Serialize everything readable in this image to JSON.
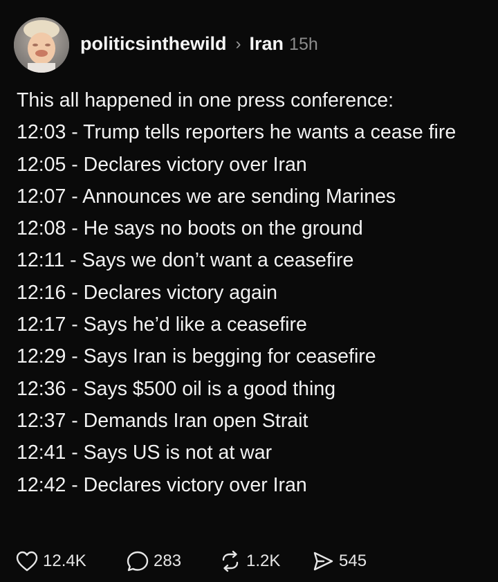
{
  "post": {
    "username": "politicsinthewild",
    "separator": "›",
    "topic": "Iran",
    "time": "15h",
    "intro": "This all happened in one press conference:",
    "entries": [
      "12:03 - Trump tells reporters he wants a cease fire",
      "12:05 - Declares victory over Iran",
      "12:07 - Announces we are sending Marines",
      "12:08 - He says no boots on the ground",
      "12:11 - Says we don’t want a ceasefire",
      "12:16 - Declares victory again",
      "12:17 - Says he’d like a ceasefire",
      "12:29 - Says Iran is begging for ceasefire",
      "12:36 - Says $500 oil is a good thing",
      "12:37 - Demands Iran open Strait",
      "12:41 - Says US is not at war",
      "12:42 - Declares victory over Iran"
    ]
  },
  "actions": {
    "likes": "12.4K",
    "replies": "283",
    "reposts": "1.2K",
    "shares": "545"
  },
  "icons": {
    "like": "heart-icon",
    "reply": "speech-bubble-icon",
    "repost": "repost-arrows-icon",
    "share": "send-icon"
  },
  "colors": {
    "background": "#0a0a0a",
    "text": "#f2f2f2",
    "muted": "#8c8c8c"
  }
}
